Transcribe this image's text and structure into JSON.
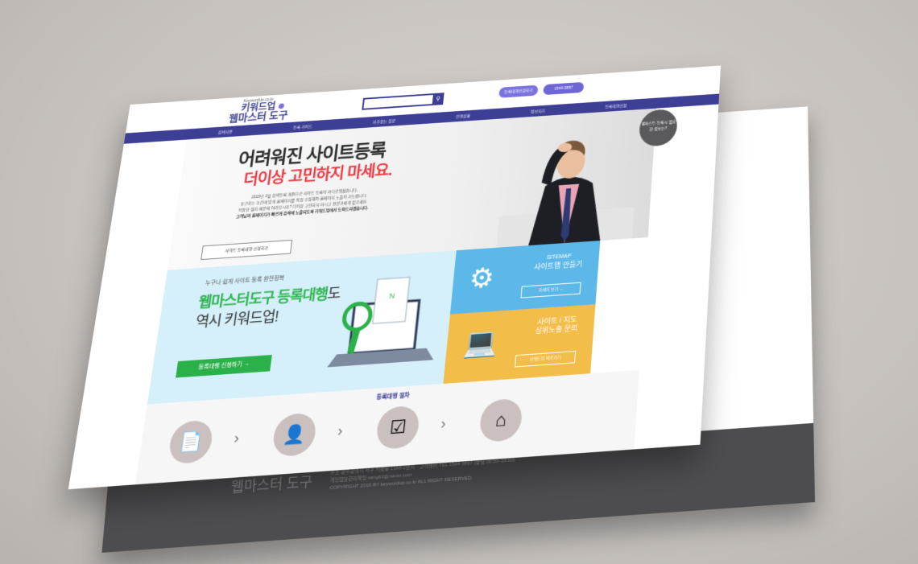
{
  "header": {
    "logo_small": "KeywordUp.co.kr",
    "logo_line1": "키워드업",
    "logo_line2": "웹마스터 도구",
    "pill1": "등록대행신청하기",
    "pill2": "1544-3897"
  },
  "nav": [
    "검색사용",
    "등록 가이드",
    "자주묻는 질문",
    "진행상황",
    "정보지기",
    "등록대행신청"
  ],
  "hero": {
    "title": "어려워진 사이트등록",
    "subtitle": "더이상 고민하지 마세요.",
    "para_lines": [
      "2015년 3월 검색등록 개편으로 사이트 등록이 까다로워졌습니다.",
      "요구하는 조건에 맞게 홈페이지를 직접 수정해야 홈페이지 노출이 가능합니다.",
      "복잡한 절차 때문에 어려우시죠? 더이상 고민하지 마시고 전문가에게 맡기세요.",
      "고객님의 홈페이지가 빠르게 검색에 노출되도록 키워드업에서 도와드리겠습니다."
    ],
    "cta": "사이트 등록대행 신청하기"
  },
  "help_bubble": "웹마스트 등록시 필요한 정보는?",
  "promo": {
    "sub": "누구나 쉽게 사이트 등록 완전정복",
    "title_green": "웹마스터도구 등록대행",
    "title_dark": "도",
    "title2": "역시 키워드업!",
    "button": "등록대행 신청하기 →"
  },
  "tiles": {
    "sitemap_title": "SITEMAP",
    "sitemap_sub": "사이트맵 만들기",
    "sitemap_btn": "자세히 보기 →",
    "site_title": "사이트 / 지도",
    "site_sub": "상위노출 문의",
    "site_btn": "키워드업 바로가기"
  },
  "process": {
    "title": "등록대행 절차"
  },
  "footer": {
    "logo": "웹마스터 도구",
    "line1": "주소 광주광역시 서구 치평동 1388-2번지 · 고객센터 TEL 1544-3897 (평일 09:00~18:00)",
    "line2": "개인정보관리책임 sang63@naver.com",
    "copyright": "COPYRIGHT 2016 BY keywordup.co.kr ALL RIGHT RESERVED."
  }
}
